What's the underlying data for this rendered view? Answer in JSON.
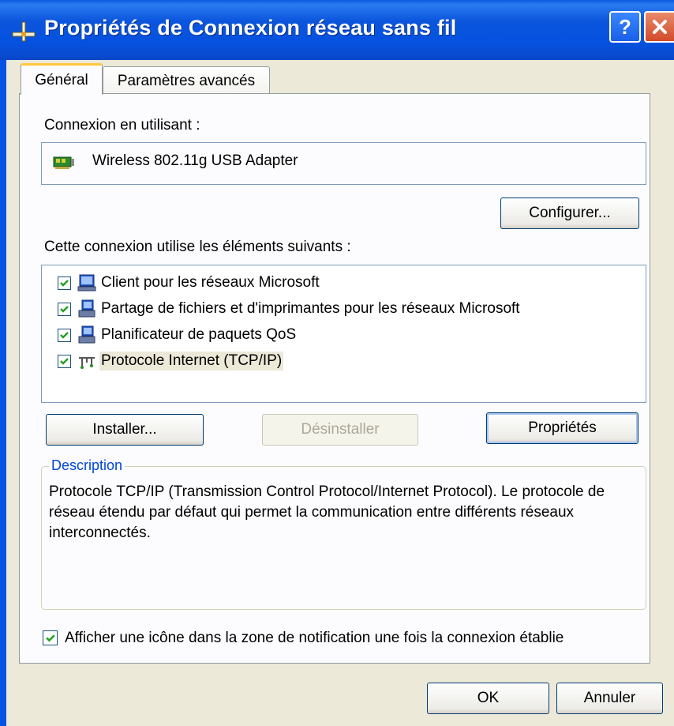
{
  "window": {
    "title": "Propriétés de Connexion réseau sans fil",
    "help_label": "?",
    "close_label": "X"
  },
  "tabs": [
    {
      "label": "Général",
      "active": true
    },
    {
      "label": "Paramètres avancés",
      "active": false
    }
  ],
  "connection": {
    "label": "Connexion en utilisant :",
    "adapter_name": "Wireless 802.11g USB Adapter",
    "adapter_icon": "network-card-icon",
    "configure_button": "Configurer..."
  },
  "components": {
    "label": "Cette connexion utilise les éléments suivants :",
    "items": [
      {
        "label": "Client pour les réseaux Microsoft",
        "checked": true,
        "icon": "network-client-icon",
        "selected": false
      },
      {
        "label": "Partage de fichiers et d'imprimantes pour les réseaux Microsoft",
        "checked": true,
        "icon": "network-service-icon",
        "selected": false
      },
      {
        "label": "Planificateur de paquets QoS",
        "checked": true,
        "icon": "network-service-icon",
        "selected": false
      },
      {
        "label": "Protocole Internet (TCP/IP)",
        "checked": true,
        "icon": "network-protocol-icon",
        "selected": true
      }
    ],
    "install_button": "Installer...",
    "uninstall_button": "Désinstaller",
    "properties_button": "Propriétés"
  },
  "description": {
    "legend": "Description",
    "text": "Protocole TCP/IP (Transmission Control Protocol/Internet Protocol). Le protocole de réseau étendu par défaut qui permet la communication entre différents réseaux interconnectés."
  },
  "notification": {
    "label": "Afficher une icône dans la zone de notification une fois la connexion établie",
    "checked": true
  },
  "footer": {
    "ok_button": "OK",
    "cancel_button": "Annuler"
  },
  "colors": {
    "titlebar": "#0552e0",
    "dialog_bg": "#ece9d8",
    "accent_tab": "#ffc83c",
    "legend_text": "#0046d5",
    "check_green": "#21a121"
  }
}
